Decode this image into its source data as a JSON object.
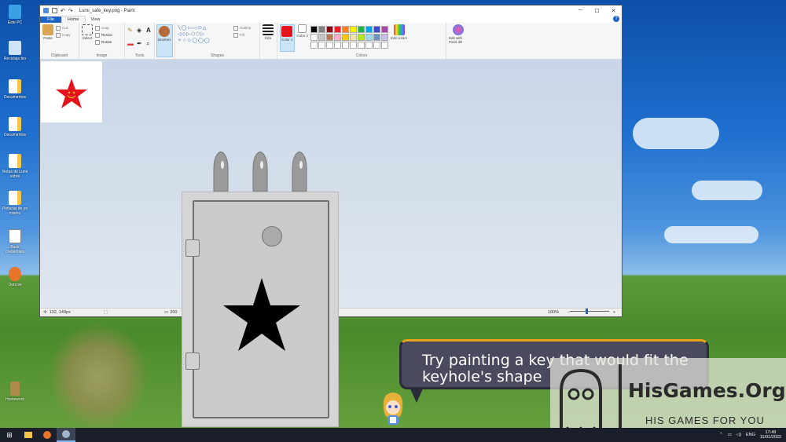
{
  "desktop": {
    "icons": [
      {
        "label": "Este PC",
        "icon": "computer-icon"
      },
      {
        "label": "Reciclaje bin",
        "icon": "recycle-bin-icon"
      },
      {
        "label": "Documentos",
        "icon": "document-icon"
      },
      {
        "label": "Documentos",
        "icon": "document-icon"
      },
      {
        "label": "Notas de Lumi sobre",
        "icon": "document-icon"
      },
      {
        "label": "Pinturas de yo mismo",
        "icon": "document-icon"
      },
      {
        "label": "Back credentials",
        "icon": "text-file-icon"
      },
      {
        "label": "Outcow",
        "icon": "app-icon"
      },
      {
        "label": "Homework",
        "icon": "folder-icon"
      }
    ]
  },
  "paint": {
    "title": "Lumi_safe_key.png - Paint",
    "window_buttons": [
      "─",
      "☐",
      "✕"
    ],
    "menu": {
      "file": "File",
      "home": "Home",
      "view": "View",
      "help": "?"
    },
    "ribbon": {
      "clipboard": {
        "name": "Clipboard",
        "paste": "Paste",
        "cut": "Cut",
        "copy": "Copy"
      },
      "image": {
        "name": "Image",
        "select": "Select",
        "crop": "Crop",
        "resize": "Resize",
        "rotate": "Rotate"
      },
      "tools": {
        "name": "Tools"
      },
      "brushes": {
        "label": "Brushes"
      },
      "shapes": {
        "name": "Shapes",
        "outline": "Outline",
        "fill": "Fill"
      },
      "size": {
        "label": "Size"
      },
      "color1": {
        "label": "Color 1",
        "value": "#e5141c"
      },
      "color2": {
        "label": "Color 2",
        "value": "#ffffff"
      },
      "colors": {
        "name": "Colors",
        "edit_colors": "Edit colors",
        "edit_3d": "Edit with Paint 3D"
      },
      "palette": [
        "#000000",
        "#7f7f7f",
        "#880015",
        "#ed1c24",
        "#ff7f27",
        "#fff200",
        "#22b14c",
        "#00a2e8",
        "#3f48cc",
        "#a349a4",
        "#ffffff",
        "#c3c3c3",
        "#b97a57",
        "#ffaec9",
        "#ffc90e",
        "#efe4b0",
        "#b5e61d",
        "#99d9ea",
        "#7092be",
        "#c8bfe7",
        "#ffffff",
        "#ffffff",
        "#ffffff",
        "#ffffff",
        "#ffffff",
        "#ffffff",
        "#ffffff",
        "#ffffff",
        "#ffffff",
        "#ffffff"
      ]
    },
    "status": {
      "position": "132, 149px",
      "size": "200",
      "zoom": "100%"
    }
  },
  "game": {
    "dialogue": "Try painting a key that would fit the keyhole's shape"
  },
  "watermark": {
    "title": "HisGames.Org",
    "subtitle": "HIS GAMES FOR YOU"
  },
  "taskbar": {
    "lang": "ENG",
    "time": "17:49",
    "date": "11/01/2022"
  }
}
